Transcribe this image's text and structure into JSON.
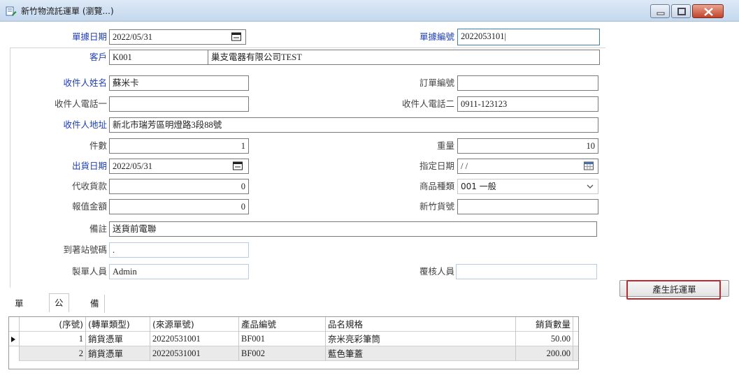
{
  "window": {
    "title": "新竹物流託運單 (瀏覽...)"
  },
  "header": {
    "doc_date_label": "單據日期",
    "doc_date": "2022/05/31",
    "doc_no_label": "單據編號",
    "doc_no": "2022053101|",
    "customer_label": "客戶",
    "customer_code": "K001",
    "customer_name": "巢支電器有限公司TEST"
  },
  "form": {
    "recipient_name_label": "收件人姓名",
    "recipient_name": "蘇米卡",
    "order_no_label": "訂單編號",
    "order_no": "",
    "phone1_label": "收件人電話一",
    "phone1": "",
    "phone2_label": "收件人電話二",
    "phone2": "0911-123123",
    "address_label": "收件人地址",
    "address": "新北市瑞芳區明燈路3段88號",
    "pieces_label": "件數",
    "pieces": "1",
    "weight_label": "重量",
    "weight": "10",
    "ship_date_label": "出貨日期",
    "ship_date": "2022/05/31",
    "assigned_date_label": "指定日期",
    "assigned_date": " / /",
    "cod_label": "代收貨款",
    "cod": "0",
    "category_label": "商品種類",
    "category": "001 一般",
    "declared_label": "報值金額",
    "declared": "0",
    "hct_no_label": "新竹貨號",
    "hct_no": "",
    "remark_label": "備註",
    "remark": "送貨前電聯",
    "station_label": "到著站號碼",
    "station": ".",
    "maker_label": "製單人員",
    "maker": "Admin",
    "reviewer_label": "覆核人員",
    "reviewer": ""
  },
  "actions": {
    "generate_label": "產生託運單"
  },
  "tabs": [
    {
      "label": "單據"
    },
    {
      "label": "公司"
    },
    {
      "label": "備註"
    }
  ],
  "grid": {
    "headers": [
      "(序號)",
      "(轉單類型)",
      "(來源單號)",
      "產品編號",
      "品名規格",
      "銷貨數量"
    ],
    "rows": [
      {
        "seq": "1",
        "type": "銷貨憑單",
        "source": "20220531001",
        "code": "BF001",
        "name": "奈米亮彩筆筒",
        "qty": "50.00"
      },
      {
        "seq": "2",
        "type": "銷貨憑單",
        "source": "20220531001",
        "code": "BF002",
        "name": "藍色筆蓋",
        "qty": "200.00"
      }
    ]
  },
  "colors": {
    "label_blue": "#1f3fb3",
    "highlight_red": "#c0282e"
  }
}
